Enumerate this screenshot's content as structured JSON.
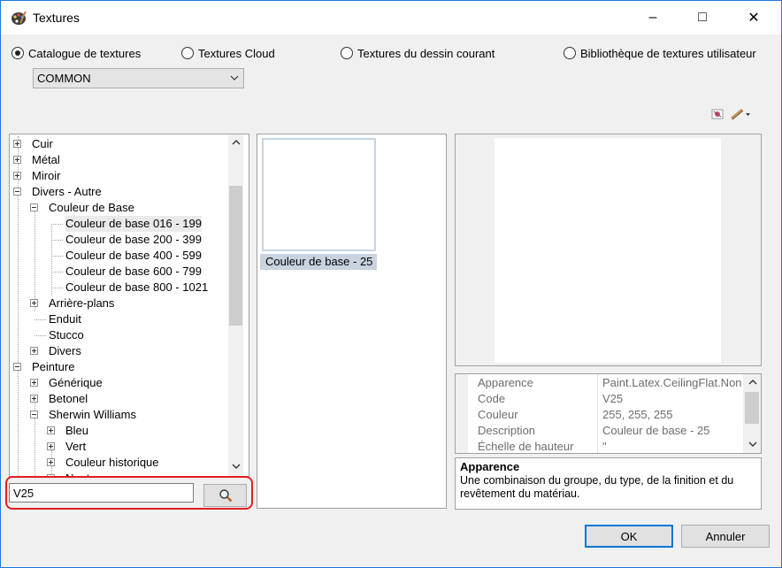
{
  "window": {
    "title": "Textures",
    "minimize": "–",
    "maximize": "□",
    "close": "✕"
  },
  "sources": [
    {
      "label": "Catalogue de textures",
      "checked": true
    },
    {
      "label": "Textures Cloud",
      "checked": false
    },
    {
      "label": "Textures du dessin courant",
      "checked": false
    },
    {
      "label": "Bibliothèque de textures utilisateur",
      "checked": false
    }
  ],
  "catalog_select": {
    "value": "COMMON"
  },
  "tree": [
    {
      "label": "Cuir",
      "expander": "plus"
    },
    {
      "label": "Métal",
      "expander": "plus"
    },
    {
      "label": "Miroir",
      "expander": "plus"
    },
    {
      "label": "Divers - Autre",
      "expander": "minus"
    },
    {
      "label": "Couleur de Base",
      "expander": "minus"
    },
    {
      "label": "Couleur de base 016 - 199",
      "expander": "none",
      "selected": true
    },
    {
      "label": "Couleur de base 200 - 399",
      "expander": "none"
    },
    {
      "label": "Couleur de base 400 - 599",
      "expander": "none"
    },
    {
      "label": "Couleur de base 600 - 799",
      "expander": "none"
    },
    {
      "label": "Couleur de base 800 - 1021",
      "expander": "none"
    },
    {
      "label": "Arrière-plans",
      "expander": "plus"
    },
    {
      "label": "Enduit",
      "expander": "none"
    },
    {
      "label": "Stucco",
      "expander": "none"
    },
    {
      "label": "Divers",
      "expander": "plus"
    },
    {
      "label": "Peinture",
      "expander": "minus"
    },
    {
      "label": "Générique",
      "expander": "plus"
    },
    {
      "label": "Betonel",
      "expander": "plus"
    },
    {
      "label": "Sherwin Williams",
      "expander": "minus"
    },
    {
      "label": "Bleu",
      "expander": "plus"
    },
    {
      "label": "Vert",
      "expander": "plus"
    },
    {
      "label": "Couleur historique",
      "expander": "plus"
    },
    {
      "label": "Neutre",
      "expander": "plus"
    }
  ],
  "search": {
    "value": "V25"
  },
  "thumbnails": [
    {
      "label": "Couleur de base - 25"
    }
  ],
  "properties": [
    {
      "name": "Apparence",
      "value": "Paint.Latex.CeilingFlat.Non"
    },
    {
      "name": "Code",
      "value": "V25"
    },
    {
      "name": "Couleur",
      "value": "255, 255, 255"
    },
    {
      "name": "Description",
      "value": "Couleur de base - 25"
    },
    {
      "name": "Échelle de hauteur",
      "value": "\""
    }
  ],
  "description": {
    "title": "Apparence",
    "text": "Une combinaison du groupe, du type, de la finition et du revêtement du matériau."
  },
  "buttons": {
    "ok": "OK",
    "cancel": "Annuler"
  },
  "colors": {
    "accent": "#0078d7",
    "highlight": "#e41e1e"
  }
}
